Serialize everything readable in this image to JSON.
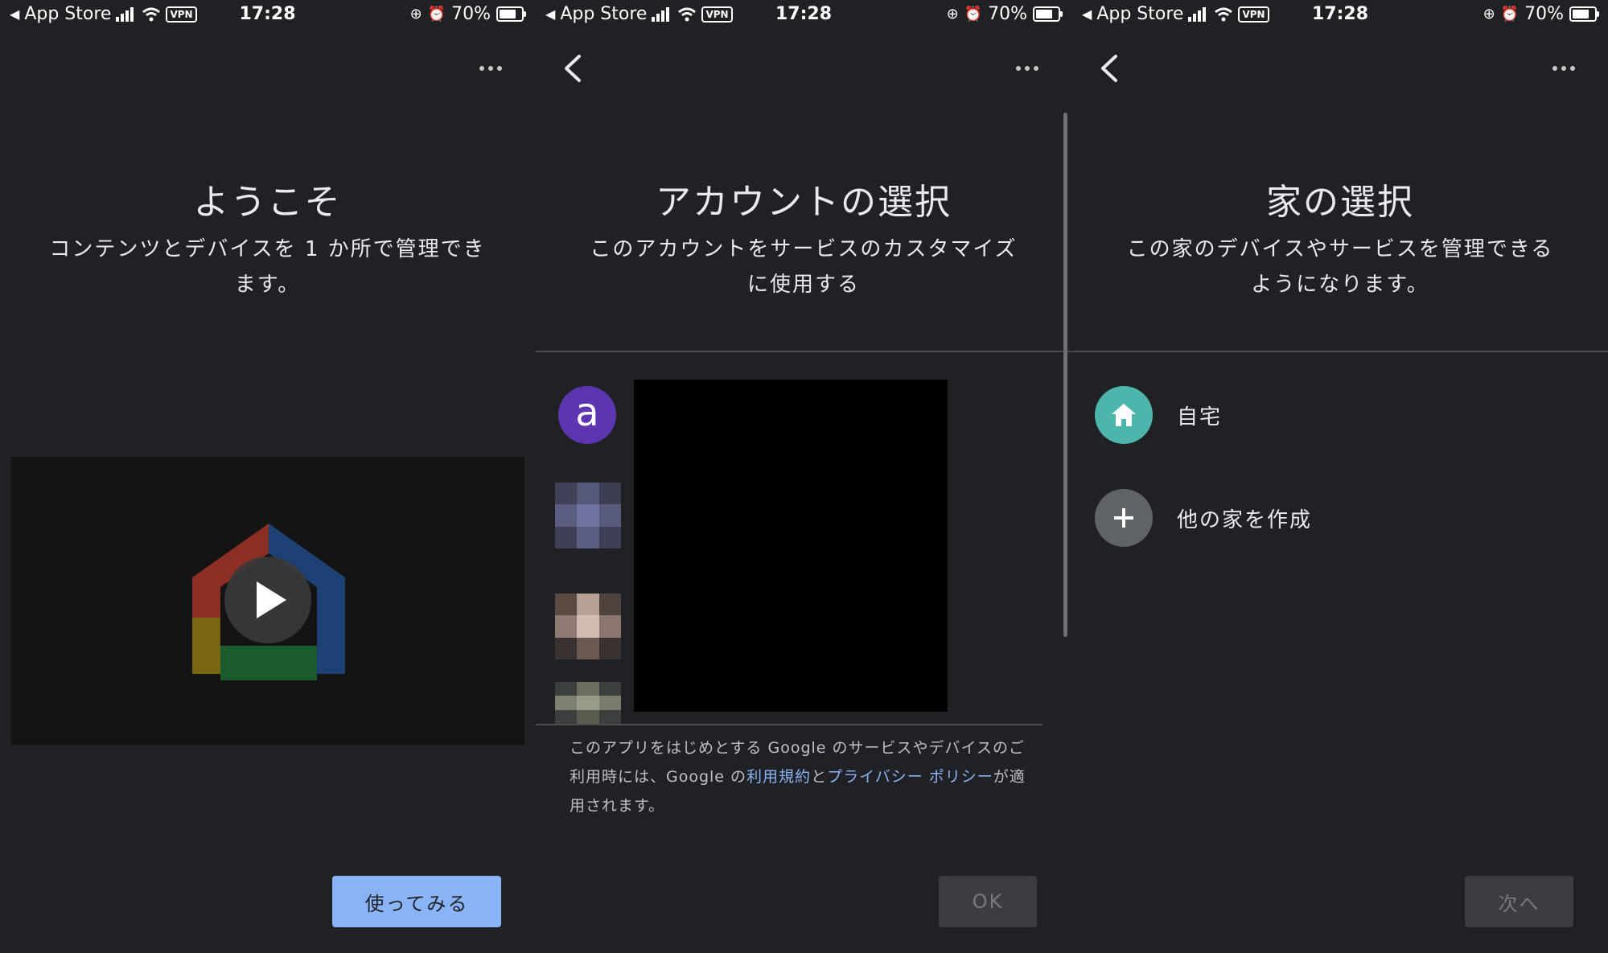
{
  "status_bar": {
    "back_app": "App Store",
    "vpn": "VPN",
    "time": "17:28",
    "battery": "70%"
  },
  "panel_welcome": {
    "title": "ようこそ",
    "subtitle": "コンテンツとデバイスを 1 か所で管理できます。",
    "cta": "使ってみる"
  },
  "panel_account": {
    "title": "アカウントの選択",
    "subtitle": "このアカウントをサービスのカスタマイズに使用する",
    "avatar_letter": "a",
    "legal_pre": "このアプリをはじめとする Google のサービスやデバイスのご利用時には、Google の",
    "legal_terms": "利用規約",
    "legal_and": "と",
    "legal_privacy": "プライバシー ポリシー",
    "legal_post": "が適用されます。",
    "ok": "OK"
  },
  "panel_home": {
    "title": "家の選択",
    "subtitle": "この家のデバイスやサービスを管理できるようになります。",
    "homes": [
      {
        "label": "自宅",
        "icon": "home-icon"
      },
      {
        "label": "他の家を作成",
        "icon": "plus-icon"
      }
    ],
    "next": "次へ"
  },
  "colors": {
    "background": "#202124",
    "primary_button": "#8ab4f8",
    "avatar_purple": "#5e35b1",
    "home_teal": "#4db6ac",
    "add_grey": "#5f6368",
    "link": "#8ab4f8"
  }
}
